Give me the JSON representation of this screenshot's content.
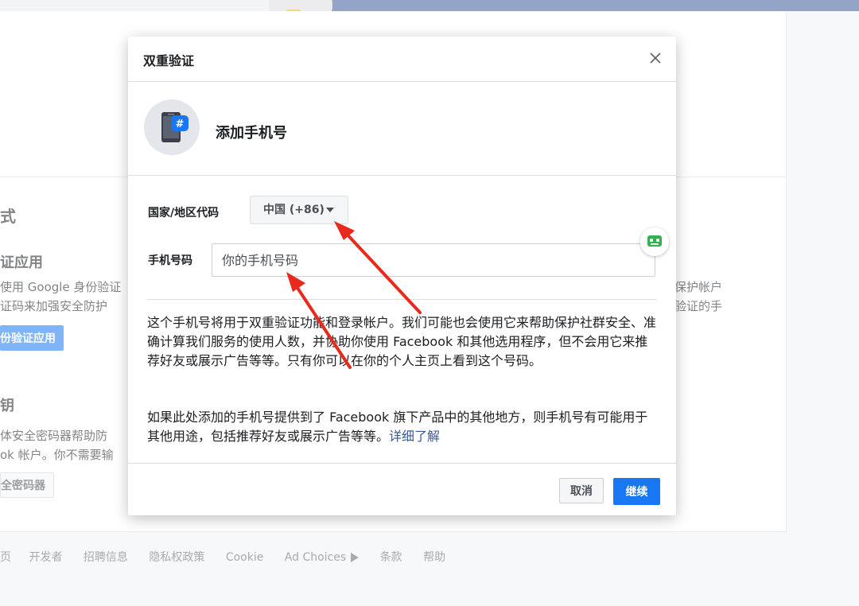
{
  "background": {
    "section_heading": "式",
    "auth_app_title": "证应用",
    "auth_app_line1": "使用 Google 身份验证",
    "auth_app_line2": "证码来加强安全防护",
    "auth_app_right1": "保护帐户",
    "auth_app_right2": "验证的手",
    "auth_app_button": "份验证应用",
    "key_title": "钥",
    "key_line1": "体安全密码器帮助防",
    "key_line2": "ok 帐户。你不需要输",
    "key_button": "全密码器"
  },
  "footer": {
    "links": [
      "页",
      "开发者",
      "招聘信息",
      "隐私权政策",
      "Cookie",
      "Ad Choices",
      "条款",
      "帮助"
    ]
  },
  "modal": {
    "title": "双重验证",
    "close_label": "×",
    "add_phone_title": "添加手机号",
    "country_label": "国家/地区代码",
    "country_value": "中国 (+86)",
    "phone_label": "手机号码",
    "phone_placeholder": "你的手机号码",
    "para1": "这个手机号将用于双重验证功能和登录帐户。我们可能也会使用它来帮助保护社群安全、准确计算我们服务的使用人数，并协助你使用 Facebook 和其他选用程序，但不会用它来推荐好友或展示广告等等。只有你可以在你的个人主页上看到这个号码。",
    "para2": "如果此处添加的手机号提供到了 Facebook 旗下产品中的其他地方，则手机号有可能用于其他用途，包括推荐好友或展示广告等等。",
    "learn_more": "详细了解",
    "cancel_label": "取消",
    "continue_label": "继续"
  },
  "colors": {
    "brand_blue": "#1877f2",
    "header_blue": "#3b5998",
    "arrow_red": "#e8291c",
    "link_blue": "#385898"
  }
}
